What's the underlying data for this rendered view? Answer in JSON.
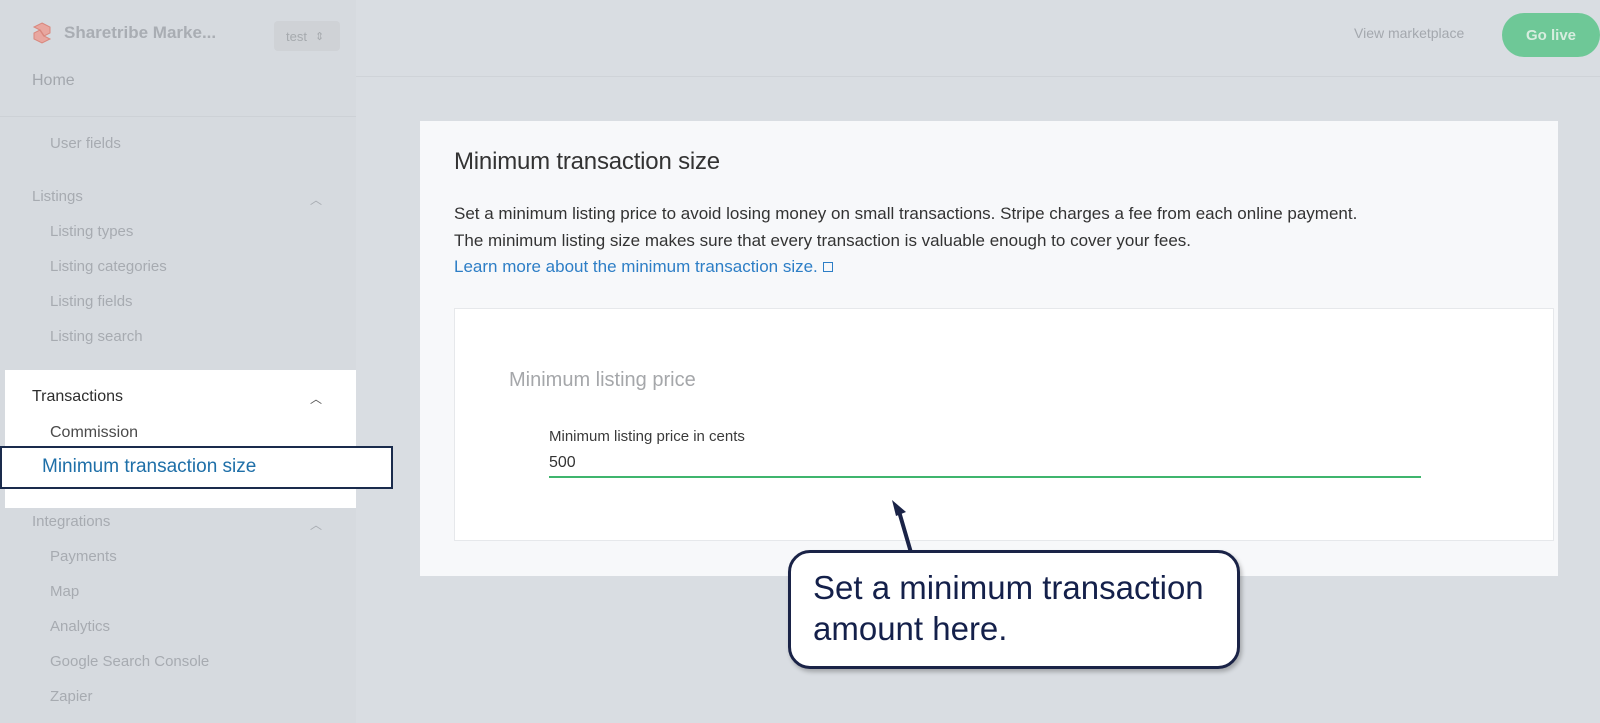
{
  "brand": {
    "name": "Sharetribe Marke...",
    "env": "test"
  },
  "sidebar": {
    "home": "Home",
    "items": [
      {
        "label": "User fields"
      },
      {
        "label": "Listings"
      },
      {
        "label": "Listing types"
      },
      {
        "label": "Listing categories"
      },
      {
        "label": "Listing fields"
      },
      {
        "label": "Listing search"
      },
      {
        "label": "Transactions"
      },
      {
        "label": "Commission"
      },
      {
        "label": "Minimum transaction size"
      },
      {
        "label": "Integrations"
      },
      {
        "label": "Payments"
      },
      {
        "label": "Map"
      },
      {
        "label": "Analytics"
      },
      {
        "label": "Google Search Console"
      },
      {
        "label": "Zapier"
      }
    ]
  },
  "topbar": {
    "view_marketplace": "View marketplace",
    "go_live": "Go live"
  },
  "main": {
    "title": "Minimum transaction size",
    "description": "Set a minimum listing price to avoid losing money on small transactions. Stripe charges a fee from each online payment. The minimum listing size makes sure that every transaction is valuable enough to cover your fees.",
    "learn_more": "Learn more about the minimum transaction size.",
    "section_title": "Minimum listing price",
    "field_label": "Minimum listing price in cents",
    "field_value": "500"
  },
  "callout": {
    "text": "Set a minimum transaction amount here."
  },
  "colors": {
    "accent_green": "#3fb56d",
    "link_blue": "#2d7ec6",
    "callout_border": "#1a2347"
  }
}
